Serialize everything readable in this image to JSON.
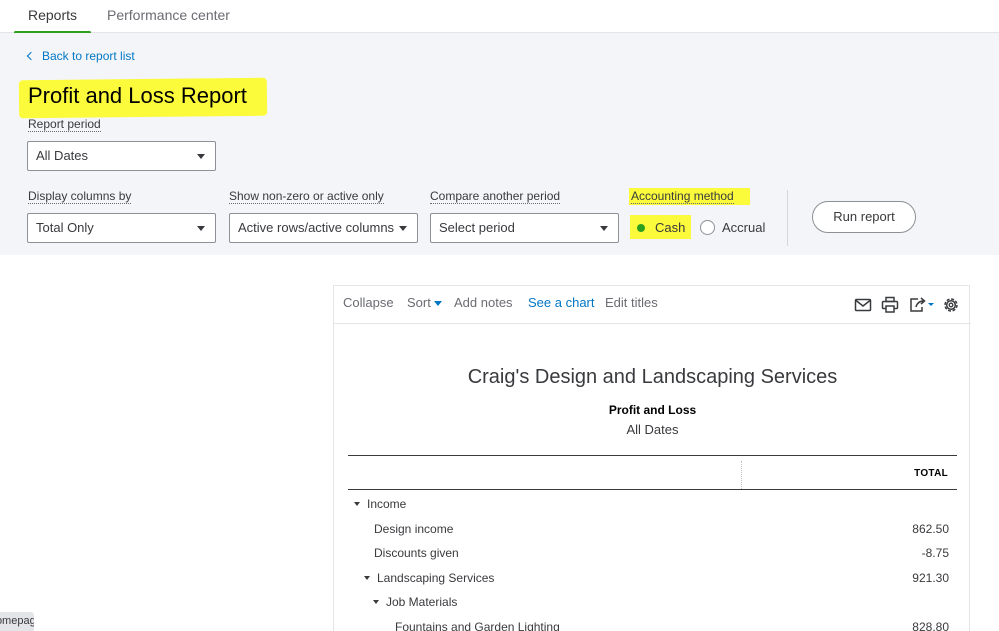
{
  "tabs": [
    {
      "label": "Reports",
      "active": true
    },
    {
      "label": "Performance center",
      "active": false
    }
  ],
  "panel": {
    "back_link": "Back to report list",
    "title": "Profit and Loss Report",
    "report_period": {
      "label": "Report period",
      "value": "All Dates"
    },
    "display_columns": {
      "label": "Display columns by",
      "value": "Total Only"
    },
    "nonzero": {
      "label": "Show non-zero or active only",
      "value": "Active rows/active columns"
    },
    "compare": {
      "label": "Compare another period",
      "value": "Select period"
    },
    "accounting": {
      "label": "Accounting method",
      "cash": "Cash",
      "accrual": "Accrual",
      "selected": "Cash"
    },
    "run_report": "Run report"
  },
  "toolbar": {
    "collapse": "Collapse",
    "sort": "Sort",
    "add_notes": "Add notes",
    "see_chart": "See a chart",
    "edit_titles": "Edit titles"
  },
  "report": {
    "company": "Craig's Design and Landscaping Services",
    "title": "Profit and Loss",
    "period": "All Dates",
    "total_header": "TOTAL",
    "rows": [
      {
        "name": "Income",
        "value": "",
        "indent": 0,
        "expandable": true
      },
      {
        "name": "Design income",
        "value": "862.50",
        "indent": 1,
        "expandable": false
      },
      {
        "name": "Discounts given",
        "value": "-8.75",
        "indent": 1,
        "expandable": false
      },
      {
        "name": "Landscaping Services",
        "value": "921.30",
        "indent": 1,
        "expandable": true
      },
      {
        "name": "Job Materials",
        "value": "",
        "indent": 2,
        "expandable": true
      },
      {
        "name": "Fountains and Garden Lighting",
        "value": "828.80",
        "indent": 3,
        "expandable": false
      }
    ]
  },
  "footer": {
    "homepage_tab": "Homepage"
  },
  "colors": {
    "accent_green": "#2ca01c",
    "link_blue": "#0077c5",
    "highlight": "#fbfb3c"
  }
}
